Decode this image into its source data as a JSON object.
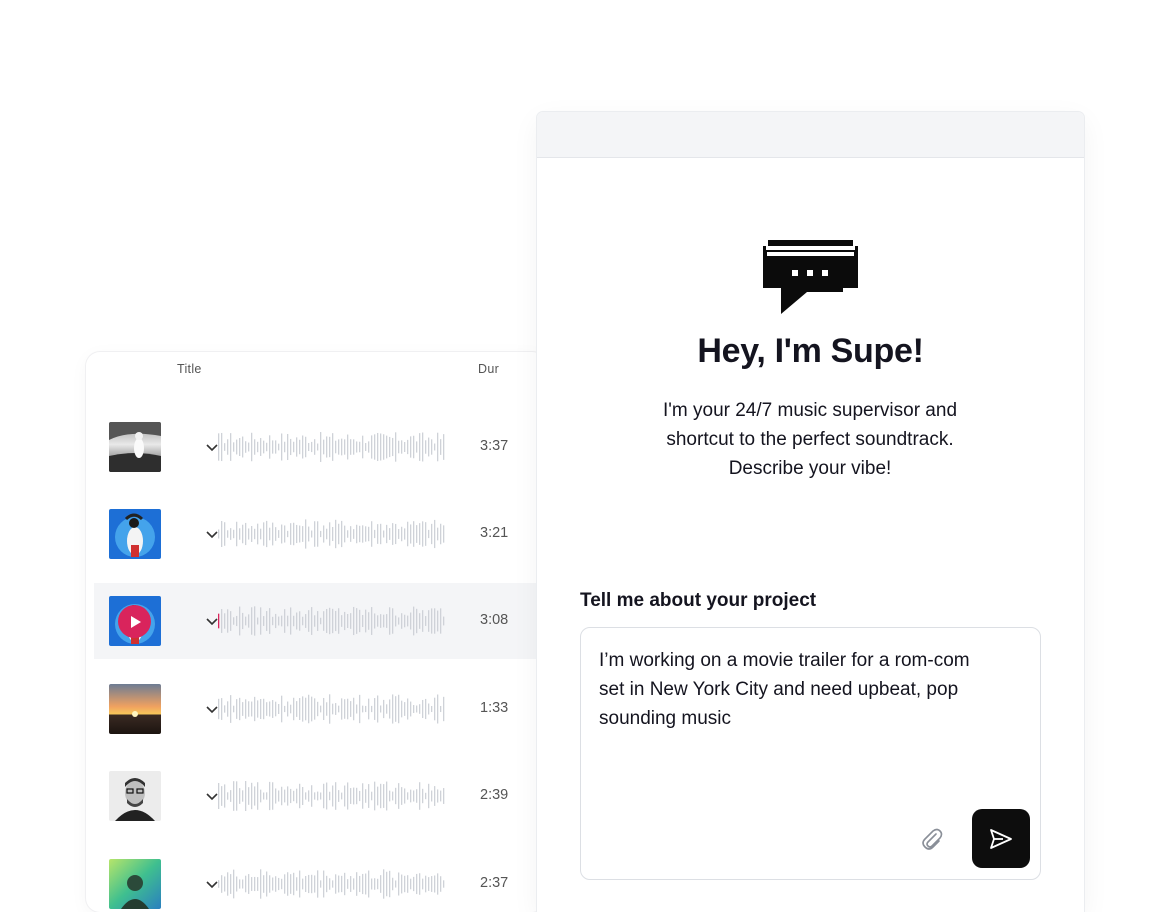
{
  "track_list": {
    "columns": {
      "title": "Title",
      "duration": "Dur"
    },
    "tracks": [
      {
        "duration": "3:37",
        "art": "bw-portrait-art"
      },
      {
        "duration": "3:21",
        "art": "blue-pose-art"
      },
      {
        "duration": "3:08",
        "art": "blue-pose-art",
        "active": true,
        "playing_icon": "play-icon"
      },
      {
        "duration": "1:33",
        "art": "sunset-art"
      },
      {
        "duration": "2:39",
        "art": "bearded-man-art"
      },
      {
        "duration": "2:37",
        "art": "green-gradient-art"
      }
    ]
  },
  "chat": {
    "logo_icon": "chat-bubble-logo-icon",
    "greeting": "Hey, I'm Supe!",
    "intro_lines": [
      "I'm your 24/7 music supervisor and",
      "shortcut to the perfect soundtrack.",
      "Describe your vibe!"
    ],
    "prompt_label": "Tell me about your project",
    "input_value": "I’m working on a movie trailer for a rom-com set in New York City and need upbeat, pop sounding music",
    "attach_icon": "paperclip-icon",
    "send_icon": "send-icon"
  },
  "colors": {
    "accent": "#d9245c",
    "active_row": "#f4f5f7",
    "waveform": "#cfd2d8",
    "send_button": "#0d0d0d"
  }
}
